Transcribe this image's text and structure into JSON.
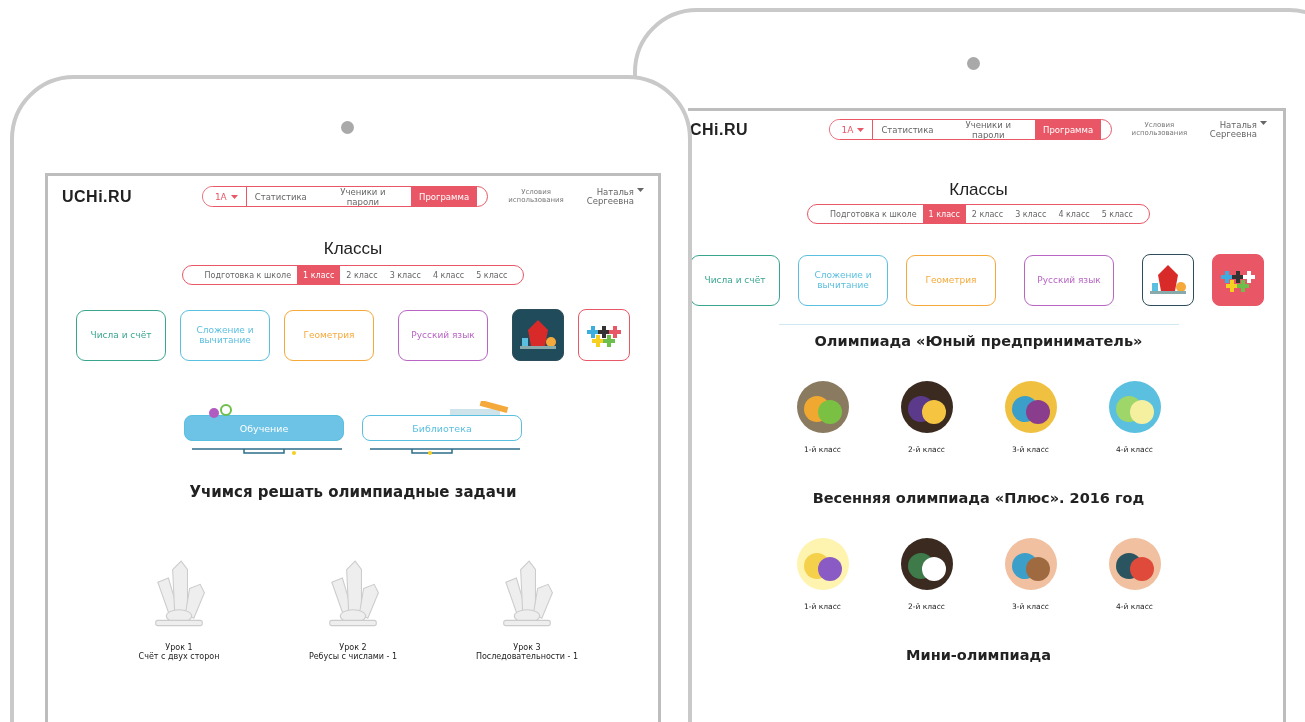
{
  "devices": [
    {
      "header": {
        "logo": "UCHi.RU",
        "class_dropdown": "1А",
        "nav": [
          {
            "label": "Статистика",
            "selected": false
          },
          {
            "label": "Ученики и пароли",
            "selected": false
          },
          {
            "label": "Программа",
            "selected": true
          }
        ],
        "terms": "Условия использования",
        "user": "Наталья Сергеевна"
      },
      "title": "Классы",
      "grades": [
        {
          "label": "Подготовка к школе",
          "selected": false
        },
        {
          "label": "1 класс",
          "selected": true
        },
        {
          "label": "2 класс",
          "selected": false
        },
        {
          "label": "3 класс",
          "selected": false
        },
        {
          "label": "4 класс",
          "selected": false
        },
        {
          "label": "5 класс",
          "selected": false
        }
      ],
      "subjects": [
        {
          "kind": "text",
          "label": "Числа и счёт",
          "color": "#3aa58f"
        },
        {
          "kind": "text",
          "label": "Сложение и вычитание",
          "color": "#5bbfe0"
        },
        {
          "kind": "text",
          "label": "Геометрия",
          "color": "#f5a93a"
        },
        {
          "kind": "text",
          "label": "Русский язык",
          "color": "#b865c4"
        },
        {
          "kind": "lab",
          "filled": true
        },
        {
          "kind": "olympic",
          "filled": false
        }
      ],
      "modes": [
        {
          "label": "Обучение",
          "selected": true
        },
        {
          "label": "Библиотека",
          "selected": false
        }
      ],
      "sections": [
        {
          "kind": "lessons",
          "title": "Учимся решать олимпиадные задачи",
          "items": [
            {
              "title": "Урок 1",
              "subtitle": "Счёт с двух сторон"
            },
            {
              "title": "Урок 2",
              "subtitle": "Ребусы с числами - 1"
            },
            {
              "title": "Урок 3",
              "subtitle": "Последовательности - 1"
            }
          ]
        }
      ]
    },
    {
      "header": {
        "logo": "CHi.RU",
        "class_dropdown": "1А",
        "nav": [
          {
            "label": "Статистика",
            "selected": false
          },
          {
            "label": "Ученики и пароли",
            "selected": false
          },
          {
            "label": "Программа",
            "selected": true
          }
        ],
        "terms": "Условия использования",
        "user": "Наталья Сергеевна"
      },
      "title": "Классы",
      "grades": [
        {
          "label": "Подготовка к школе",
          "selected": false
        },
        {
          "label": "1 класс",
          "selected": true
        },
        {
          "label": "2 класс",
          "selected": false
        },
        {
          "label": "3 класс",
          "selected": false
        },
        {
          "label": "4 класс",
          "selected": false
        },
        {
          "label": "5 класс",
          "selected": false
        }
      ],
      "subjects": [
        {
          "kind": "text",
          "label": "Числа и счёт",
          "color": "#3aa58f"
        },
        {
          "kind": "text",
          "label": "Сложение и вычитание",
          "color": "#5bbfe0"
        },
        {
          "kind": "text",
          "label": "Геометрия",
          "color": "#f5a93a"
        },
        {
          "kind": "text",
          "label": "Русский язык",
          "color": "#b865c4"
        },
        {
          "kind": "lab",
          "filled": false
        },
        {
          "kind": "olympic",
          "filled": true
        }
      ],
      "sections": [
        {
          "kind": "olympiad",
          "title": "Олимпиада «Юный предприниматель»",
          "items": [
            {
              "label": "1-й класс"
            },
            {
              "label": "2-й класс"
            },
            {
              "label": "3-й класс"
            },
            {
              "label": "4-й класс"
            }
          ]
        },
        {
          "kind": "olympiad",
          "title": "Весенняя олимпиада «Плюс». 2016 год",
          "items": [
            {
              "label": "1-й класс"
            },
            {
              "label": "2-й класс"
            },
            {
              "label": "3-й класс"
            },
            {
              "label": "4-й класс"
            }
          ]
        },
        {
          "kind": "olympiad",
          "title": "Мини-олимпиада"
        }
      ]
    }
  ]
}
